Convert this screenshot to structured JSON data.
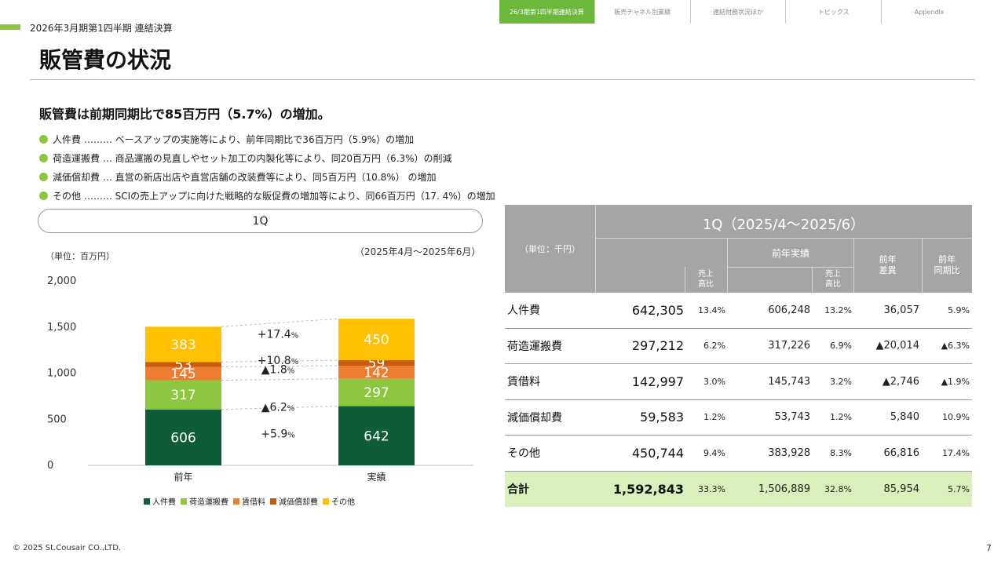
{
  "nav": {
    "tabs": [
      "26/3期第1四半期連結決算",
      "販売チャネル別業績",
      "連結財務状況ほか",
      "トピックス",
      "Appendix"
    ],
    "active_index": 0
  },
  "header": {
    "subtitle": "2026年3月期第1四半期 連結決算",
    "title": "販管費の状況"
  },
  "summary": {
    "headline": "販管費は前期同期比で85百万円（5.7%）の増加。",
    "bullets": [
      "人件費 ……… ベースアップの実施等により、前年同期比で36百万円（5.9%）の増加",
      "荷造運搬費 … 商品運搬の見直しやセット加工の内製化等により、同20百万円（6.3%）の削減",
      "減価償却費 … 直営の新店出店や直営店舗の改装費等により、同5百万円（10.8%） の増加",
      "その他 ……… SCIの売上アップに向けた戦略的な販促費の増加等により、同66百万円（17. 4%）の増加"
    ]
  },
  "chart_section": {
    "pill_label": "1Q",
    "unit": "（単位：百万円）",
    "period": "（2025年4月～2025年6月）"
  },
  "chart_data": {
    "type": "bar",
    "stacked": true,
    "categories": [
      "前年",
      "実績"
    ],
    "series": [
      {
        "name": "人件費",
        "values": [
          606,
          642
        ],
        "color": "#0f5c38",
        "change": "+5.9"
      },
      {
        "name": "荷造運搬費",
        "values": [
          317,
          297
        ],
        "color": "#8dc63f",
        "change": "▲6.2"
      },
      {
        "name": "賃借料",
        "values": [
          145,
          142
        ],
        "color": "#ee7d31",
        "change": "▲1.8"
      },
      {
        "name": "減価償却費",
        "values": [
          53,
          59
        ],
        "color": "#c55a11",
        "change": "+10.8"
      },
      {
        "name": "その他",
        "values": [
          383,
          450
        ],
        "color": "#ffc000",
        "change": "+17.4"
      }
    ],
    "ylim": [
      0,
      2000
    ],
    "yticks": [
      0,
      500,
      1000,
      1500,
      2000
    ],
    "change_unit": "%",
    "grid": false,
    "legend_position": "bottom"
  },
  "table": {
    "unit": "（単位：千円）",
    "period_header": "1Q（2025/4～2025/6）",
    "prev_header": "前年実績",
    "ratio_header": "売上\n高比",
    "diff_header": "前年\n差異",
    "yoy_header": "前年\n同期比",
    "rows": [
      {
        "label": "人件費",
        "actual": "642,305",
        "actual_ratio": "13.4%",
        "prev": "606,248",
        "prev_ratio": "13.2%",
        "diff": "36,057",
        "yoy": "5.9%"
      },
      {
        "label": "荷造運搬費",
        "actual": "297,212",
        "actual_ratio": "6.2%",
        "prev": "317,226",
        "prev_ratio": "6.9%",
        "diff": "▲20,014",
        "yoy": "▲6.3%"
      },
      {
        "label": "賃借料",
        "actual": "142,997",
        "actual_ratio": "3.0%",
        "prev": "145,743",
        "prev_ratio": "3.2%",
        "diff": "▲2,746",
        "yoy": "▲1.9%"
      },
      {
        "label": "減価償却費",
        "actual": "59,583",
        "actual_ratio": "1.2%",
        "prev": "53,743",
        "prev_ratio": "1.2%",
        "diff": "5,840",
        "yoy": "10.9%"
      },
      {
        "label": "その他",
        "actual": "450,744",
        "actual_ratio": "9.4%",
        "prev": "383,928",
        "prev_ratio": "8.3%",
        "diff": "66,816",
        "yoy": "17.4%"
      },
      {
        "label": "合計",
        "actual": "1,592,843",
        "actual_ratio": "33.3%",
        "prev": "1,506,889",
        "prev_ratio": "32.8%",
        "diff": "85,954",
        "yoy": "5.7%"
      }
    ]
  },
  "footer": {
    "copyright": "© 2025 St.Cousair CO.,LTD.",
    "page": "7"
  }
}
